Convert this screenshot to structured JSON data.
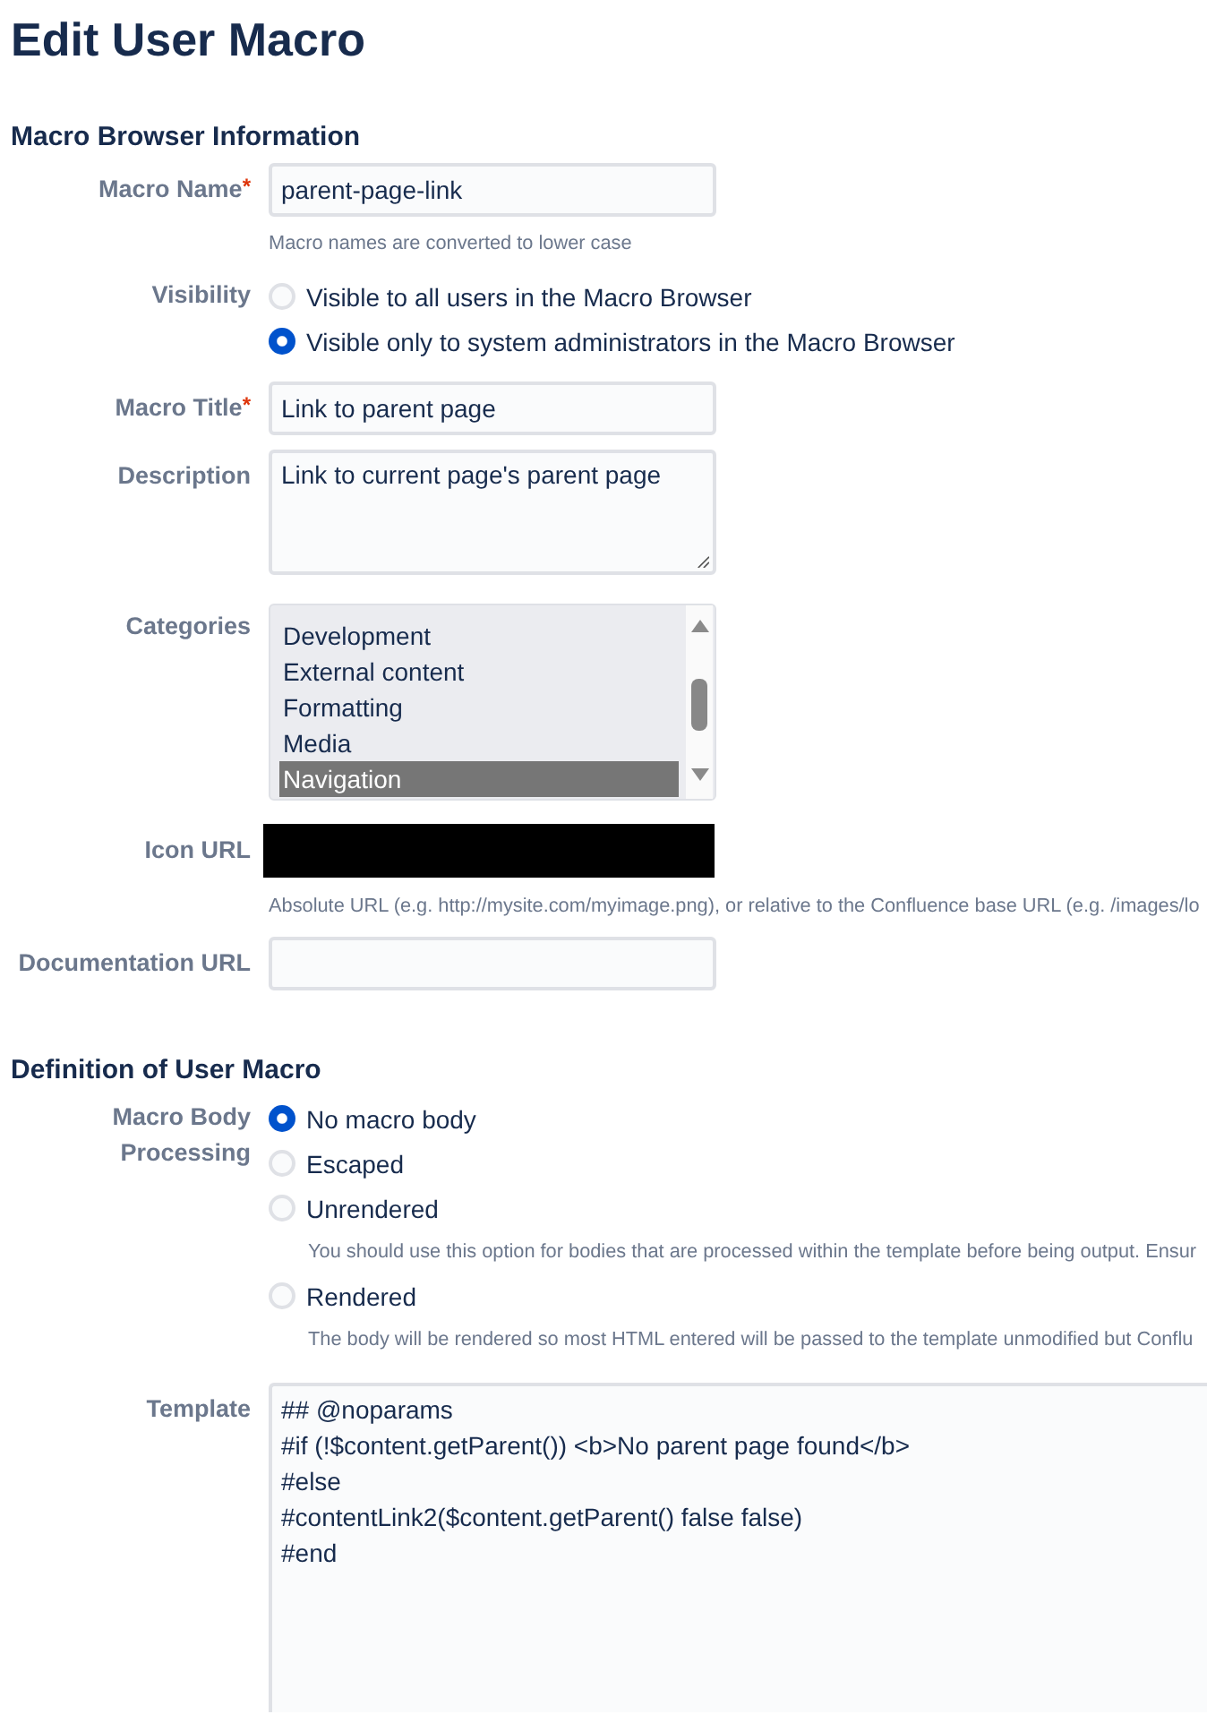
{
  "page": {
    "title": "Edit User Macro"
  },
  "sections": [
    {
      "heading": "Macro Browser Information",
      "fields": [
        {
          "kind": "text",
          "label": "Macro Name",
          "required_marker": "*",
          "value": "parent-page-link",
          "help": "Macro names are converted to lower case"
        },
        {
          "kind": "radio",
          "label": "Visibility",
          "options": [
            {
              "label": "Visible to all users in the Macro Browser",
              "selected": false
            },
            {
              "label": "Visible only to system administrators in the Macro Browser",
              "selected": true
            }
          ]
        },
        {
          "kind": "text",
          "label": "Macro Title",
          "required_marker": "*",
          "value": "Link to parent page"
        },
        {
          "kind": "textarea",
          "label": "Description",
          "value": "Link to current page's parent page"
        },
        {
          "kind": "listbox",
          "label": "Categories",
          "options": [
            {
              "label": "Development",
              "selected": false
            },
            {
              "label": "External content",
              "selected": false
            },
            {
              "label": "Formatting",
              "selected": false
            },
            {
              "label": "Media",
              "selected": false
            },
            {
              "label": "Navigation",
              "selected": true
            }
          ]
        },
        {
          "kind": "redacted",
          "label": "Icon URL",
          "help": "Absolute URL (e.g. http://mysite.com/myimage.png), or relative to the Confluence base URL (e.g. /images/lo"
        },
        {
          "kind": "text",
          "label": "Documentation URL"
        }
      ]
    },
    {
      "heading": "Definition of User Macro",
      "fields": [
        {
          "kind": "radio",
          "label": "Macro Body Processing",
          "options": [
            {
              "label": "No macro body",
              "selected": true
            },
            {
              "label": "Escaped",
              "selected": false
            },
            {
              "label": "Unrendered",
              "selected": false,
              "help": "You should use this option for bodies that are processed within the template before being output. Ensur"
            },
            {
              "label": "Rendered",
              "selected": false,
              "help": "The body will be rendered so most HTML entered will be passed to the template unmodified but Conflu"
            }
          ]
        },
        {
          "kind": "code",
          "label": "Template",
          "lines": [
            "## @noparams",
            "#if (!$content.getParent()) <b>No parent page found</b>",
            "#else",
            "#contentLink2($content.getParent() false false)",
            "#end"
          ]
        }
      ]
    }
  ]
}
